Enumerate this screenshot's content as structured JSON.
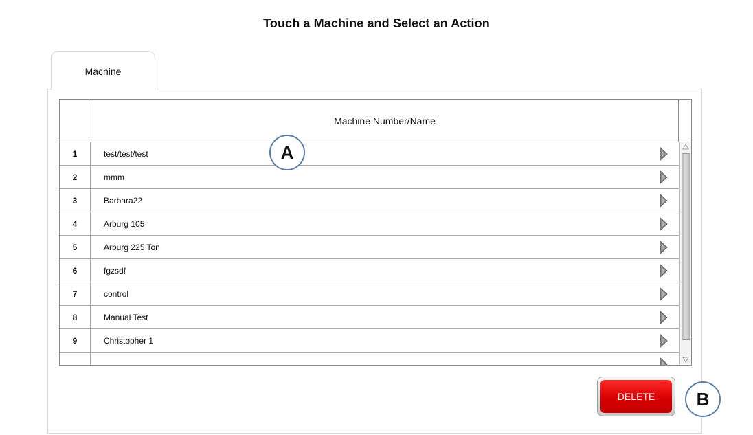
{
  "header": {
    "title": "Touch a Machine and Select an Action"
  },
  "tabs": [
    {
      "label": "Machine"
    }
  ],
  "table": {
    "column_header": "Machine Number/Name",
    "rows": [
      {
        "num": "1",
        "name": "test/test/test"
      },
      {
        "num": "2",
        "name": "mmm"
      },
      {
        "num": "3",
        "name": "Barbara22"
      },
      {
        "num": "4",
        "name": "Arburg 105"
      },
      {
        "num": "5",
        "name": "Arburg 225 Ton"
      },
      {
        "num": "6",
        "name": "fgzsdf"
      },
      {
        "num": "7",
        "name": "control"
      },
      {
        "num": "8",
        "name": "Manual Test"
      },
      {
        "num": "9",
        "name": "Christopher 1"
      },
      {
        "num": "",
        "name": ""
      }
    ],
    "row_action_icon": "play-arrow-icon"
  },
  "actions": {
    "delete_label": "DELETE"
  },
  "callouts": {
    "a": "A",
    "b": "B"
  },
  "colors": {
    "delete_red": "#e00000",
    "callout_border": "#5b7fa8",
    "arrow_fill": "#8a8a8a"
  }
}
